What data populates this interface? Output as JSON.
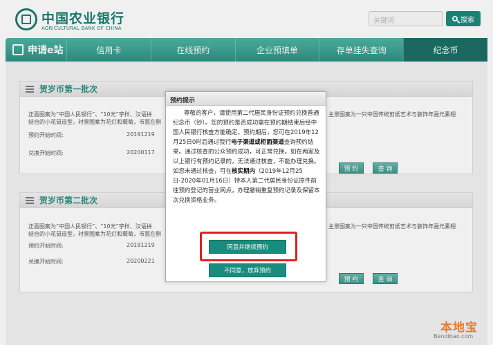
{
  "header": {
    "logo_cn": "中国农业银行",
    "logo_en": "AGRICULTURAL BANK OF CHINA",
    "search_placeholder": "关键词",
    "search_button": "搜索"
  },
  "nav": {
    "home": "申请e站",
    "items": [
      "信用卡",
      "在线预约",
      "企业预填单",
      "存单挂失查询",
      "纪念币"
    ],
    "active": "纪念币"
  },
  "batch1": {
    "title": "贺岁币第一批次",
    "desc_left_1": "正面图案为“中国人民银行”、“10元”字样、汉语拼",
    "desc_left_2": "结合的小花鼠造型，衬景图案为花灯和葡萄，币面左侧",
    "desc_right": "主景图案为一只中国传统剪纸艺术与装饰年画元素相",
    "reserve_label": "预约开始时间:",
    "reserve_value": "20191219",
    "exchange_label": "兑换开始时间:",
    "exchange_value": "20200117",
    "reserve_btn": "预 约",
    "query_btn": "查 询"
  },
  "batch2": {
    "title": "贺岁币第二批次",
    "desc_left_1": "正面图案为“中国人民银行”、“10元”字样、汉语拼",
    "desc_left_2": "结合的小花鼠造型，衬景图案为花灯和葡萄，币面左侧",
    "desc_right": "主景图案为一只中国传统剪纸艺术与装饰年画元素相",
    "reserve_label": "预约开始时间:",
    "reserve_value": "20191219",
    "exchange_label": "兑换开始时间:",
    "exchange_value": "20200221",
    "reserve_btn": "预 约",
    "query_btn": "查 询"
  },
  "modal": {
    "title": "预约提示",
    "p1": "尊敬的客户，请使用第二代居民身份证预约兑换普通纪念币（钞）。您的预约是否成功需在预约期结束后经中国人民银行核查方能确定。预约期后，您可在2019年12月25日0时后通过我行",
    "p1_bold": "电子渠道或柜面渠道",
    "p2": "查询预约结果。通过核查的公众预约成功，可正常兑换。如在两家及以上银行有预约记录的，无法通过核查，不能办理兑换。如您未通过核查，可在",
    "p2_bold": "核实期内",
    "p3": "（2019年12月25日-2020年01月16日）持本人第二代居民身份证原件前往预约登记的营业网点，办理撤销重复预约记录及保留本次兑换资格业务。",
    "agree_btn": "同意并继续预约",
    "disagree_btn": "不同意，放弃预约"
  },
  "watermark": {
    "cn": "本地宝",
    "en": "Bendibao.com"
  },
  "colors": {
    "brand": "#1a8c7d",
    "highlight": "#e02020"
  }
}
